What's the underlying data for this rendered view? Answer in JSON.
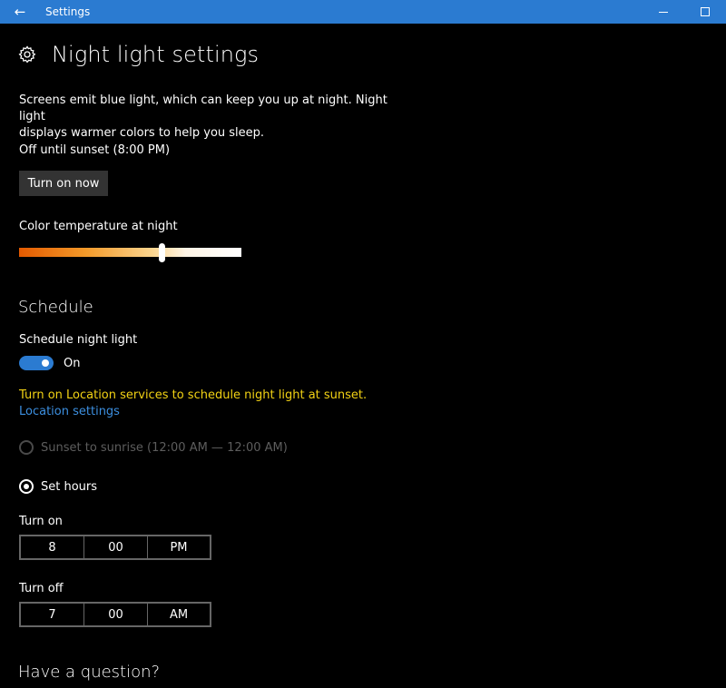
{
  "window": {
    "title": "Settings",
    "accent": "#2b7bd1"
  },
  "page": {
    "title": "Night light settings",
    "icon": "gear-icon"
  },
  "description": {
    "line1": "Screens emit blue light, which can keep you up at night. Night light",
    "line2": "displays warmer colors to help you sleep."
  },
  "status_text": "Off until sunset (8:00 PM)",
  "turn_on_button": "Turn on now",
  "color_temperature": {
    "label": "Color temperature at night",
    "value_fraction": 0.64
  },
  "schedule": {
    "section_title": "Schedule",
    "label": "Schedule night light",
    "toggle_state": "On",
    "toggle_on": true,
    "warning": "Turn on Location services to schedule night light at sunset.",
    "warning_color": "#f2d214",
    "location_link": "Location settings",
    "options": {
      "sunset": "Sunset to sunrise (12:00 AM — 12:00 AM)",
      "set_hours": "Set hours"
    },
    "selected_option": "set_hours",
    "turn_on": {
      "label": "Turn on",
      "hour": "8",
      "minute": "00",
      "period": "PM"
    },
    "turn_off": {
      "label": "Turn off",
      "hour": "7",
      "minute": "00",
      "period": "AM"
    }
  },
  "help": {
    "title": "Have a question?"
  }
}
